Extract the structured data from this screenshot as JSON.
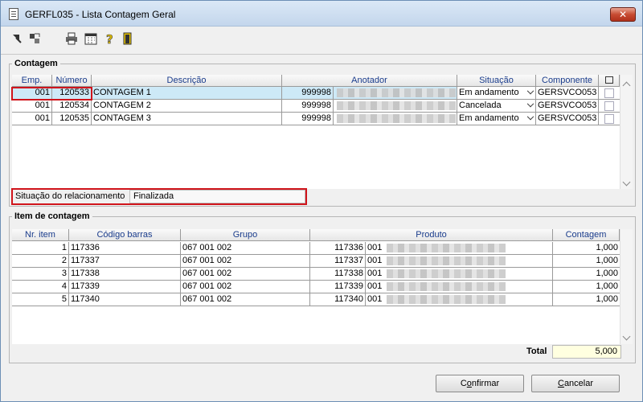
{
  "window": {
    "title": "GERFL035 - Lista Contagem Geral",
    "close_label": "✕"
  },
  "toolbar": {
    "icons": [
      "first-icon",
      "prev-icon",
      "print-icon",
      "calendar-icon",
      "help-icon",
      "exit-icon"
    ]
  },
  "contagem": {
    "legend": "Contagem",
    "columns": [
      "Emp.",
      "Número",
      "Descrição",
      "Anotador",
      "Situação",
      "Componente",
      "▢"
    ],
    "rows": [
      {
        "emp": "001",
        "numero": "120533",
        "descricao": "CONTAGEM 1",
        "anotador_cod": "999998",
        "situacao": "Em andamento",
        "componente": "GERSVCO053"
      },
      {
        "emp": "001",
        "numero": "120534",
        "descricao": "CONTAGEM 2",
        "anotador_cod": "999998",
        "situacao": "Cancelada",
        "componente": "GERSVCO053"
      },
      {
        "emp": "001",
        "numero": "120535",
        "descricao": "CONTAGEM 3",
        "anotador_cod": "999998",
        "situacao": "Em andamento",
        "componente": "GERSVCO053"
      }
    ],
    "relacionamento_label": "Situação do relacionamento",
    "relacionamento_value": "Finalizada"
  },
  "itens": {
    "legend": "Item de contagem",
    "columns": [
      "Nr. item",
      "Código barras",
      "Grupo",
      "Produto",
      "Contagem"
    ],
    "rows": [
      {
        "nr": "1",
        "codigo": "117336",
        "grupo": "067 001 002",
        "produto_cod": "117336",
        "produto_emp": "001",
        "contagem": "1,000"
      },
      {
        "nr": "2",
        "codigo": "117337",
        "grupo": "067 001 002",
        "produto_cod": "117337",
        "produto_emp": "001",
        "contagem": "1,000"
      },
      {
        "nr": "3",
        "codigo": "117338",
        "grupo": "067 001 002",
        "produto_cod": "117338",
        "produto_emp": "001",
        "contagem": "1,000"
      },
      {
        "nr": "4",
        "codigo": "117339",
        "grupo": "067 001 002",
        "produto_cod": "117339",
        "produto_emp": "001",
        "contagem": "1,000"
      },
      {
        "nr": "5",
        "codigo": "117340",
        "grupo": "067 001 002",
        "produto_cod": "117340",
        "produto_emp": "001",
        "contagem": "1,000"
      }
    ],
    "total_label": "Total",
    "total_value": "5,000"
  },
  "buttons": {
    "confirm_pre": "C",
    "confirm_u": "o",
    "confirm_post": "nfirmar",
    "cancel_pre": "",
    "cancel_u": "C",
    "cancel_post": "ancelar"
  },
  "colors": {
    "highlight": "#d0141b",
    "selected_row": "#cde9f7",
    "header_text": "#1a3c8c",
    "total_bg": "#ffffe0"
  }
}
